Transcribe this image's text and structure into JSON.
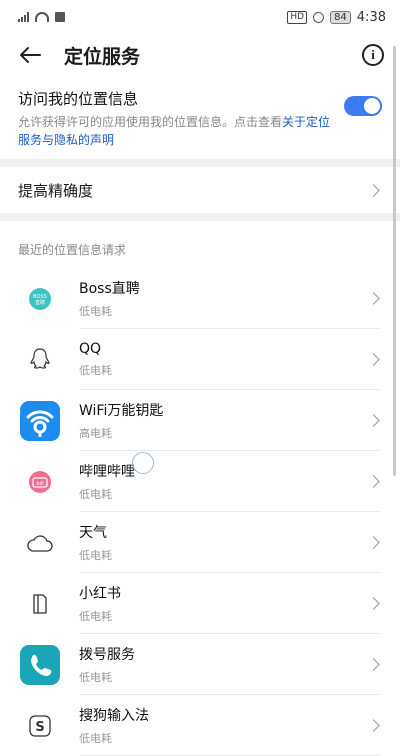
{
  "status": {
    "time": "4:38",
    "hd": "HD",
    "battery": "84"
  },
  "header": {
    "title": "定位服务"
  },
  "location_access": {
    "title": "访问我的位置信息",
    "desc_prefix": "允许获得许可的应用使用我的位置信息。点击查看",
    "link_text": "关于定位服务与隐私的声明",
    "enabled": true
  },
  "accuracy": {
    "label": "提高精确度"
  },
  "recent": {
    "header": "最近的位置信息请求",
    "apps": [
      {
        "name": "Boss直聘",
        "power": "低电耗",
        "icon": "boss-zhipin-icon",
        "icon_text": "BOSS\n直聘",
        "color": "#3cc4c2"
      },
      {
        "name": "QQ",
        "power": "低电耗",
        "icon": "qq-icon"
      },
      {
        "name": "WiFi万能钥匙",
        "power": "高电耗",
        "icon": "wifi-key-icon",
        "color": "#1d8cf0"
      },
      {
        "name": "哔哩哔哩",
        "power": "低电耗",
        "icon": "bilibili-icon",
        "icon_text": "bili",
        "color": "#f06d8f"
      },
      {
        "name": "天气",
        "power": "低电耗",
        "icon": "weather-icon"
      },
      {
        "name": "小红书",
        "power": "低电耗",
        "icon": "xiaohongshu-icon"
      },
      {
        "name": "拨号服务",
        "power": "低电耗",
        "icon": "dialer-icon",
        "color": "#1aa6b8"
      },
      {
        "name": "搜狗输入法",
        "power": "低电耗",
        "icon": "sogou-input-icon",
        "icon_text": "S"
      }
    ]
  }
}
